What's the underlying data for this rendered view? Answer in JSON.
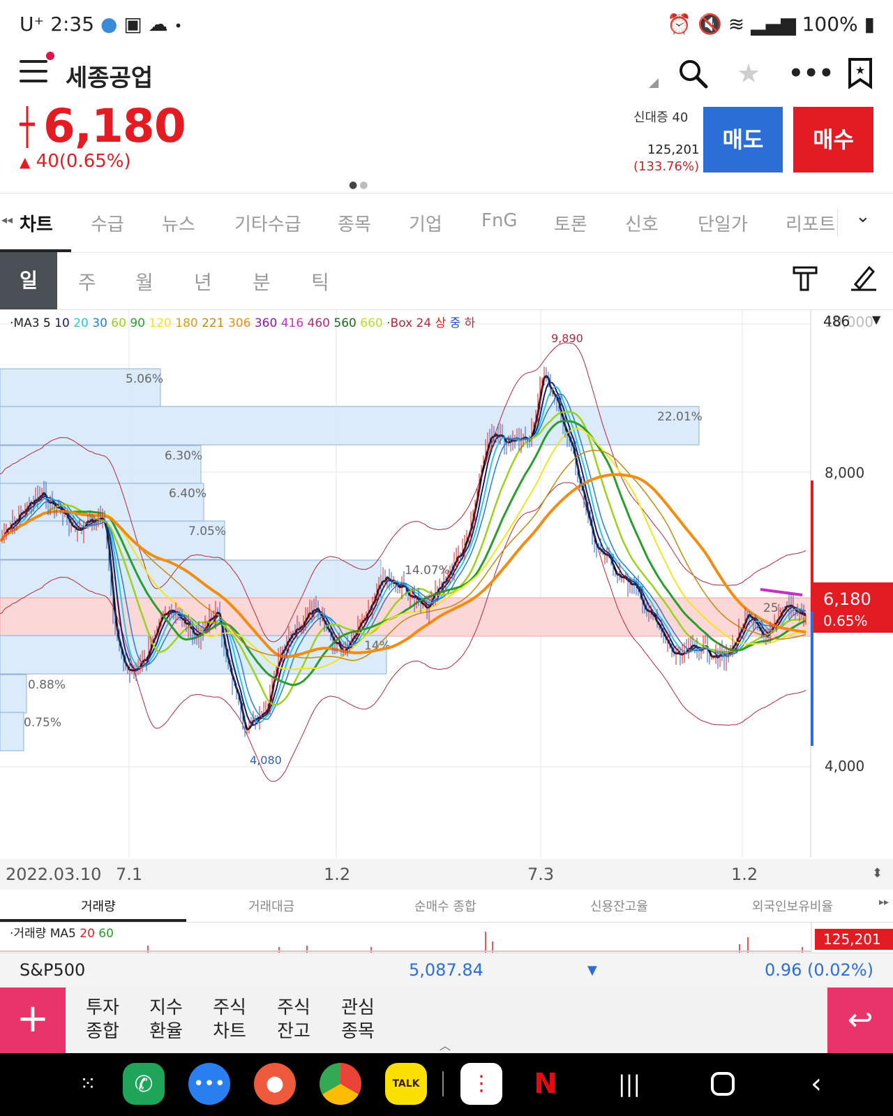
{
  "status_bar": {
    "time": "2:35",
    "carrier": "U⁺",
    "battery": "100%"
  },
  "header": {
    "stock_name": "세종공업",
    "price": "6,180",
    "change": "40(0.65%)",
    "credit_label": "신대증 40",
    "volume_now": "125,201",
    "volume_pct": "(133.76%)",
    "sell_label": "매도",
    "buy_label": "매수"
  },
  "tabs": [
    {
      "label": "차트"
    },
    {
      "label": "수급"
    },
    {
      "label": "뉴스"
    },
    {
      "label": "기타수급"
    },
    {
      "label": "종목"
    },
    {
      "label": "기업"
    },
    {
      "label": "FnG"
    },
    {
      "label": "토론"
    },
    {
      "label": "신호"
    },
    {
      "label": "단일가"
    },
    {
      "label": "리포트"
    }
  ],
  "periods": [
    {
      "label": "일"
    },
    {
      "label": "주"
    },
    {
      "label": "월"
    },
    {
      "label": "년"
    },
    {
      "label": "분"
    },
    {
      "label": "틱"
    }
  ],
  "chart": {
    "legend": [
      {
        "text": "·MA3",
        "color": "#222222"
      },
      {
        "text": "5",
        "color": "#111111"
      },
      {
        "text": "10",
        "color": "#1a1a6e"
      },
      {
        "text": "20",
        "color": "#27c6e6"
      },
      {
        "text": "30",
        "color": "#1f7fd6"
      },
      {
        "text": "60",
        "color": "#9ad21c"
      },
      {
        "text": "90",
        "color": "#2a9d2a"
      },
      {
        "text": "120",
        "color": "#f2e51a"
      },
      {
        "text": "180",
        "color": "#d4a016"
      },
      {
        "text": "221",
        "color": "#c48a10"
      },
      {
        "text": "306",
        "color": "#f28c12"
      },
      {
        "text": "360",
        "color": "#8a1aa8"
      },
      {
        "text": "416",
        "color": "#c72fc6"
      },
      {
        "text": "460",
        "color": "#b02a7e"
      },
      {
        "text": "560",
        "color": "#1d6b1d"
      },
      {
        "text": "660",
        "color": "#b8e02a"
      },
      {
        "text": "·Box 24",
        "color": "#b0283c"
      },
      {
        "text": "상",
        "color": "#e02020"
      },
      {
        "text": "중",
        "color": "#2050c8"
      },
      {
        "text": "하",
        "color": "#b0283c"
      }
    ],
    "y_ticks": [
      "10,000",
      "8,000",
      "4,000"
    ],
    "y_top_value": "486",
    "price_tag": "6,180",
    "price_tag_pct": "0.65%",
    "annotations": {
      "high": "9,890",
      "low": "4,080"
    },
    "volume_profile": [
      {
        "label": "5.06%",
        "pct": 5.06
      },
      {
        "label": "22.01%",
        "pct": 22.01
      },
      {
        "label": "6.30%",
        "pct": 6.3
      },
      {
        "label": "6.40%",
        "pct": 6.4
      },
      {
        "label": "7.05%",
        "pct": 7.05
      },
      {
        "label": "14.07%",
        "pct": 14.07
      },
      {
        "label": "25.",
        "pct": 25.0,
        "highlight": true
      },
      {
        "label": "14%",
        "pct": 14.0
      },
      {
        "label": "0.88%",
        "pct": 0.88
      },
      {
        "label": "0.75%",
        "pct": 0.75
      }
    ],
    "x_labels": [
      "2022.03.10",
      "7.1",
      "1.2",
      "7.3",
      "1.2"
    ]
  },
  "subtabs": [
    {
      "label": "거래량"
    },
    {
      "label": "거래대금"
    },
    {
      "label": "순매수 종합"
    },
    {
      "label": "신용잔고율"
    },
    {
      "label": "외국인보유비율"
    }
  ],
  "volume_pane": {
    "legend_prefix": "·거래량 MA5",
    "ma20": "20",
    "ma60": "60",
    "value": "125,201"
  },
  "index_bar": {
    "name": "S&P500",
    "value": "5,087.84",
    "change": "0.96 (0.02%)"
  },
  "bottom_menu": [
    {
      "line1": "투자",
      "line2": "종합"
    },
    {
      "line1": "지수",
      "line2": "환율"
    },
    {
      "line1": "주식",
      "line2": "차트"
    },
    {
      "line1": "주식",
      "line2": "잔고"
    },
    {
      "line1": "관심",
      "line2": "종목"
    }
  ],
  "colors": {
    "up": "#e31b23",
    "down": "#2b6fd6",
    "accent": "#e8336b"
  }
}
